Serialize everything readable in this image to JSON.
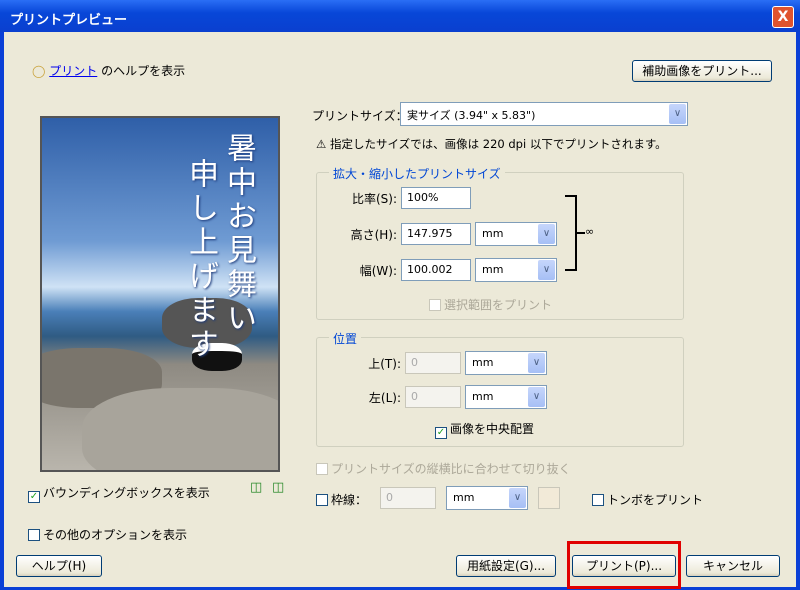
{
  "window": {
    "title": "プリントプレビュー",
    "close_label": "X"
  },
  "help": {
    "link": "プリント",
    "suffix": "のヘルプを表示"
  },
  "print_aux_button": "補助画像をプリント...",
  "preview": {
    "line1": "暑中お見舞い",
    "line2": "申し上げます"
  },
  "print_size": {
    "label": "プリントサイズ：",
    "value": "実サイズ (3.94\" x 5.83\")"
  },
  "warning": "指定したサイズでは、画像は 220 dpi 以下でプリントされます。",
  "scaled": {
    "legend": "拡大・縮小したプリントサイズ",
    "ratio_label": "比率(S):",
    "ratio_value": "100%",
    "height_label": "高さ(H):",
    "height_value": "147.975",
    "height_unit": "mm",
    "width_label": "幅(W):",
    "width_value": "100.002",
    "width_unit": "mm",
    "print_selection": "選択範囲をプリント"
  },
  "position": {
    "legend": "位置",
    "top_label": "上(T):",
    "top_value": "0",
    "top_unit": "mm",
    "left_label": "左(L):",
    "left_value": "0",
    "left_unit": "mm",
    "center": "画像を中央配置"
  },
  "crop_to_ratio": "プリントサイズの縦横比に合わせて切り抜く",
  "border": {
    "label": "枠線：",
    "value": "0",
    "unit": "mm"
  },
  "print_crop_marks": "トンボをプリント",
  "show_bounding_box": "バウンディングボックスを表示",
  "show_more_options": "その他のオプションを表示",
  "buttons": {
    "help": "ヘルプ(H)",
    "page_setup": "用紙設定(G)...",
    "print": "プリント(P)...",
    "cancel": "キャンセル"
  },
  "colors": {
    "border_swatch": "#f2ead8",
    "highlight": "#e00000"
  }
}
